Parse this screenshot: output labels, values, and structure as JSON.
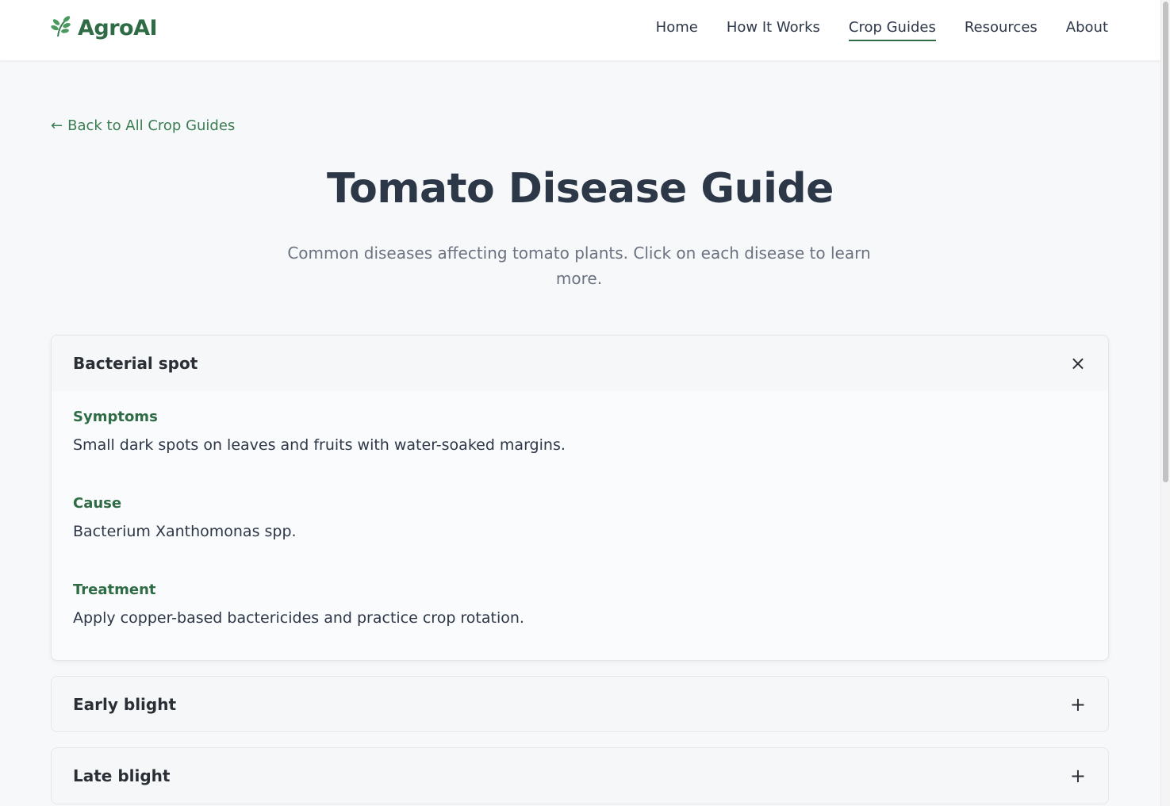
{
  "brand": {
    "name": "AgroAI",
    "icon": "leaf-icon",
    "color": "#2f6b45"
  },
  "nav": {
    "items": [
      {
        "label": "Home",
        "active": false
      },
      {
        "label": "How It Works",
        "active": false
      },
      {
        "label": "Crop Guides",
        "active": true
      },
      {
        "label": "Resources",
        "active": false
      },
      {
        "label": "About",
        "active": false
      }
    ]
  },
  "back_link": {
    "arrow": "←",
    "label": "Back to All Crop Guides"
  },
  "page": {
    "title": "Tomato Disease Guide",
    "subtitle": "Common diseases affecting tomato plants. Click on each disease to learn more."
  },
  "diseases": [
    {
      "name": "Bacterial spot",
      "expanded": true,
      "toggle": "×",
      "sections": [
        {
          "heading": "Symptoms",
          "text": "Small dark spots on leaves and fruits with water-soaked margins."
        },
        {
          "heading": "Cause",
          "text": "Bacterium Xanthomonas spp."
        },
        {
          "heading": "Treatment",
          "text": "Apply copper-based bactericides and practice crop rotation."
        }
      ]
    },
    {
      "name": "Early blight",
      "expanded": false,
      "toggle": "+"
    },
    {
      "name": "Late blight",
      "expanded": false,
      "toggle": "+"
    }
  ],
  "colors": {
    "accent": "#2f6b45",
    "link": "#3a7d52",
    "title": "#2c3748",
    "muted": "#6b7280"
  }
}
